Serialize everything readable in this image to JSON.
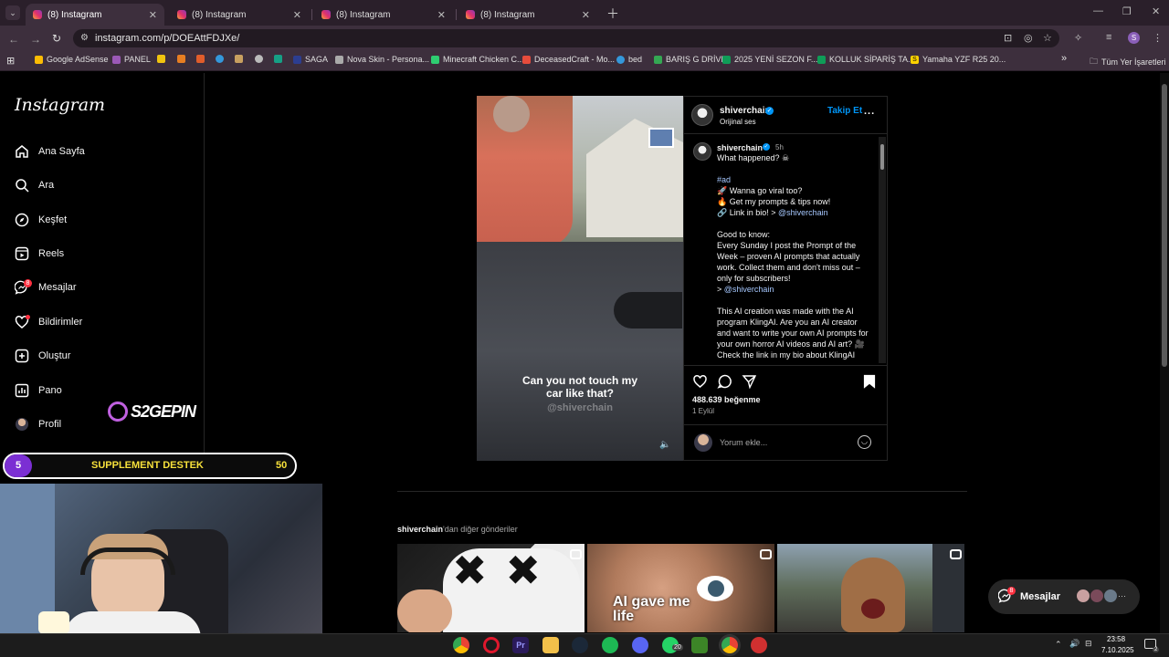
{
  "browser": {
    "tabs": [
      {
        "title": "(8) Instagram",
        "active": true
      },
      {
        "title": "(8) Instagram",
        "active": false
      },
      {
        "title": "(8) Instagram",
        "active": false
      },
      {
        "title": "(8) Instagram",
        "active": false
      }
    ],
    "url": "instagram.com/p/DOEAttFDJXe/",
    "bookmarks": [
      "Google AdSense",
      "PANEL",
      "SAGA",
      "Nova Skin - Persona...",
      "Minecraft Chicken C...",
      "DeceasedCraft - Mo...",
      "bed",
      "BARIŞ G DRİVE",
      "2025 YENİ SEZON F...",
      "KOLLUK SİPARİŞ TA...",
      "Yamaha YZF R25 20..."
    ],
    "all_bookmarks": "Tüm Yer İşaretleri",
    "profile_initial": "S",
    "bookmark_overflow": "»"
  },
  "sidebar": {
    "logo": "Instagram",
    "items": [
      {
        "label": "Ana Sayfa",
        "icon": "home-icon"
      },
      {
        "label": "Ara",
        "icon": "search-icon"
      },
      {
        "label": "Keşfet",
        "icon": "compass-icon"
      },
      {
        "label": "Reels",
        "icon": "reels-icon"
      },
      {
        "label": "Mesajlar",
        "icon": "messenger-icon",
        "badge": "8"
      },
      {
        "label": "Bildirimler",
        "icon": "heart-icon"
      },
      {
        "label": "Oluştur",
        "icon": "plus-square-icon"
      },
      {
        "label": "Pano",
        "icon": "dashboard-icon"
      },
      {
        "label": "Profil",
        "icon": "avatar"
      }
    ]
  },
  "overlay": {
    "supplement_left": "5",
    "supplement_label": "SUPPLEMENT DESTEK",
    "supplement_right": "50",
    "brand": "S2GEPIN"
  },
  "post": {
    "username": "shiverchain",
    "audio": "Orijinal ses",
    "follow": "Takip Et",
    "more": "...",
    "time": "5h",
    "video_caption": "Can you not touch my car like that?",
    "video_watermark": "@shiverchain",
    "caption_paragraphs": [
      "What happened? ☠",
      "#ad\n🚀 Wanna go viral too?\n🔥 Get my prompts & tips now!\n🔗 Link in bio! > @shiverchain",
      "Good to know:\nEvery Sunday I post the Prompt of the Week – proven AI prompts that actually work. Collect them and don't miss out – only for subscribers!\n> @shiverchain",
      "This AI creation was made with the AI program KlingAI. Are you an AI creator and want to write your own AI prompts for your own horror AI videos and AI art? 🎥\nCheck the link in my bio about KlingAI"
    ],
    "likes": "488.639 beğenme",
    "date": "1 Eylül",
    "comment_placeholder": "Yorum ekle..."
  },
  "more_posts": {
    "title_user": "shiverchain",
    "title_rest": "'dan diğer gönderiler",
    "thumb_text": "AI gave me life"
  },
  "messages_pill": {
    "label": "Mesajlar",
    "badge": "8",
    "more": "···"
  },
  "taskbar": {
    "time": "23:58",
    "date": "7.10.2025",
    "whatsapp_badge": "20",
    "notification_badge": "2"
  }
}
